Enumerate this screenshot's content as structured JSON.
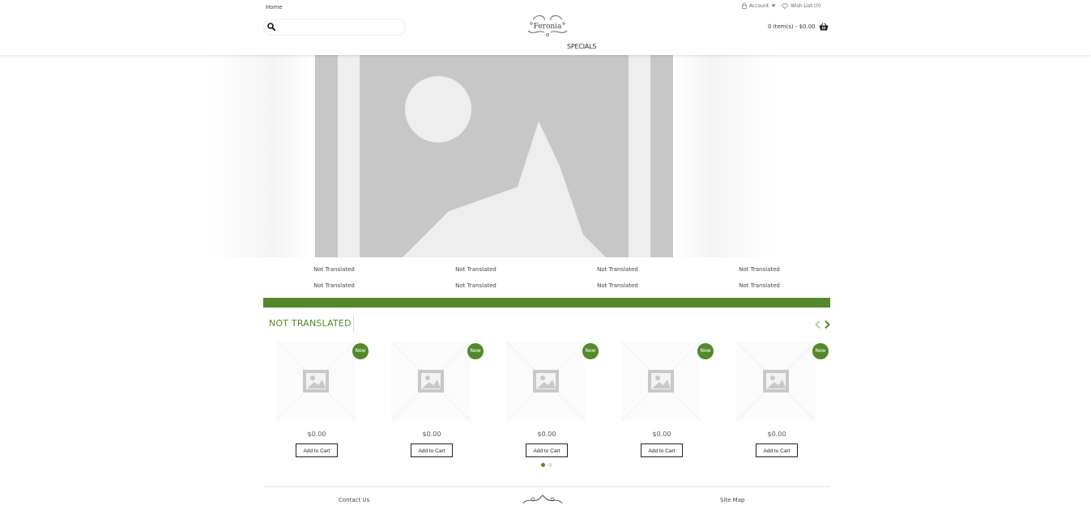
{
  "header": {
    "home_link": "Home",
    "account_label": "Account",
    "wishlist_label": "Wish List (0)",
    "cart_label": "0 item(s) - $0.00",
    "logo_text": "Feronia",
    "search": {
      "placeholder": "",
      "value": ""
    },
    "nav": {
      "specials": "SPECIALS"
    }
  },
  "links_grid": [
    [
      "Not Translated",
      "Not Translated",
      "Not Translated",
      "Not Translated"
    ],
    [
      "Not Translated",
      "Not Translated",
      "Not Translated",
      "Not Translated"
    ]
  ],
  "section": {
    "title": "NOT TRANSLATED"
  },
  "products": [
    {
      "badge": "New",
      "price": "$0.00",
      "button": "Add to Cart"
    },
    {
      "badge": "New",
      "price": "$0.00",
      "button": "Add to Cart"
    },
    {
      "badge": "New",
      "price": "$0.00",
      "button": "Add to Cart"
    },
    {
      "badge": "New",
      "price": "$0.00",
      "button": "Add to Cart"
    },
    {
      "badge": "New",
      "price": "$0.00",
      "button": "Add to Cart"
    }
  ],
  "carousel": {
    "page_count": 2,
    "active_page": 1
  },
  "footer": {
    "contact": "Contact Us",
    "sitemap": "Site Map"
  },
  "colors": {
    "accent": "#53892a",
    "placeholder_gray": "#c7c7c7",
    "placeholder_light": "#efeeef"
  }
}
